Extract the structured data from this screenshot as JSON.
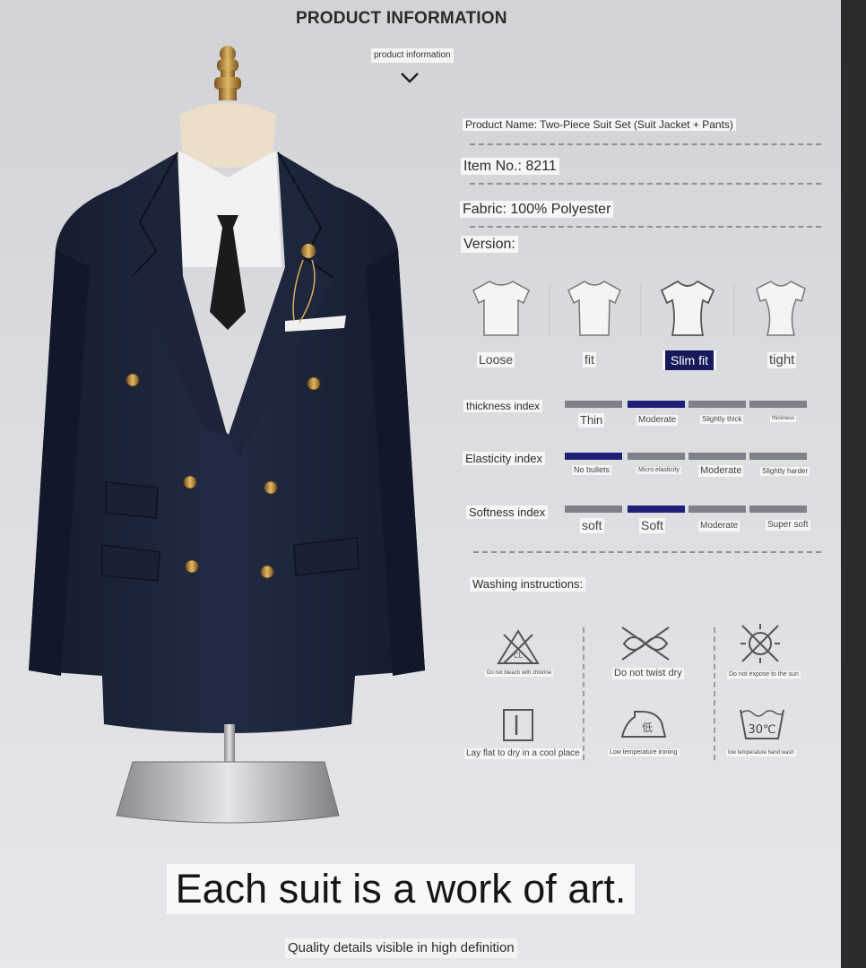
{
  "header": {
    "title": "PRODUCT INFORMATION",
    "subtitle": "product information"
  },
  "product": {
    "name": "Product Name: Two-Piece Suit Set (Suit Jacket + Pants)",
    "item_no": "Item No.: 8211",
    "fabric": "Fabric: 100% Polyester",
    "version_label": "Version:"
  },
  "version": {
    "options": [
      "Loose",
      "fit",
      "Slim fit",
      "tight"
    ],
    "selected": "Slim fit"
  },
  "indices": [
    {
      "label": "thickness index",
      "options": [
        "Thin",
        "Moderate",
        "Slightly thick",
        "thickness"
      ],
      "active_index": 1
    },
    {
      "label": "Elasticity index",
      "options": [
        "No bullets",
        "Micro elasticity",
        "Moderate",
        "Slightly harder"
      ],
      "active_index": 0
    },
    {
      "label": "Softness index",
      "options": [
        "soft",
        "Soft",
        "Moderate",
        "Super soft"
      ],
      "active_index": 1
    }
  ],
  "washing": {
    "label": "Washing instructions:",
    "items": [
      {
        "icon": "no-bleach-icon",
        "text": "Do not bleach with chlorine"
      },
      {
        "icon": "do-not-wring-icon",
        "text": "Do not twist dry"
      },
      {
        "icon": "no-sun-icon",
        "text": "Do not expose to the sun"
      },
      {
        "icon": "dry-flat-icon",
        "text": "Lay flat to dry in a cool place"
      },
      {
        "icon": "low-iron-icon",
        "text": "Low temperature ironing"
      },
      {
        "icon": "hand-wash-30-icon",
        "text": "low temperature hand wash"
      }
    ],
    "iron_glyph": "低",
    "wash_temp": "30℃"
  },
  "footer": {
    "tagline": "Each suit is a work of art.",
    "caption": "Quality details visible in high definition"
  },
  "colors": {
    "suit": "#1b2338",
    "active_bar": "#1f1f78",
    "inactive_bar": "#7f8089",
    "selected_version_bg": "#141a5a"
  }
}
